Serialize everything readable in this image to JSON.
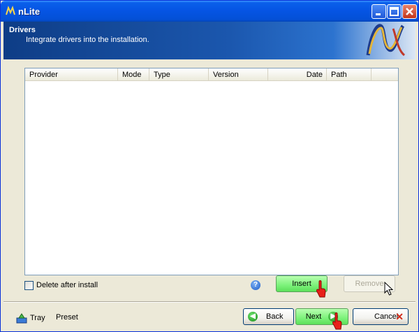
{
  "window": {
    "title": "nLite"
  },
  "banner": {
    "title": "Drivers",
    "subtitle": "Integrate drivers into the installation."
  },
  "listview": {
    "columns": [
      "Provider",
      "Mode",
      "Type",
      "Version",
      "Date",
      "Path"
    ],
    "rows": []
  },
  "options": {
    "delete_after_install_label": "Delete after install",
    "delete_after_install_checked": false
  },
  "buttons": {
    "insert": "Insert",
    "remove": "Remove",
    "back": "Back",
    "next": "Next",
    "cancel": "Cancel"
  },
  "footer": {
    "tray": "Tray",
    "preset": "Preset"
  },
  "colors": {
    "titlebar": "#0554E3",
    "highlight_green": "#7CF27A",
    "cancel_x": "#D12B1B"
  },
  "icons": {
    "app": "nlite-logo-icon",
    "help": "help-icon",
    "tray": "tray-icon",
    "back": "back-arrow-icon",
    "next": "next-arrow-icon",
    "cancel": "cancel-x-icon"
  }
}
